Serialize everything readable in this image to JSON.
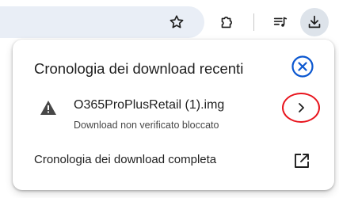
{
  "popup": {
    "title": "Cronologia dei download recenti",
    "item": {
      "filename": "O365ProPlusRetail (1).img",
      "status": "Download non verificato bloccato"
    },
    "full_history_label": "Cronologia dei download completa"
  },
  "icons": {
    "toolbar": [
      "star-icon",
      "extensions-puzzle-icon",
      "media-controls-icon",
      "download-icon"
    ],
    "popup": [
      "close-icon",
      "warning-icon",
      "chevron-right-icon",
      "open-external-icon"
    ]
  },
  "colors": {
    "accent": "#0b57d0",
    "annotation": "#e8141d",
    "omnibox": "#e9eef6",
    "active_button": "#dde3ea"
  }
}
